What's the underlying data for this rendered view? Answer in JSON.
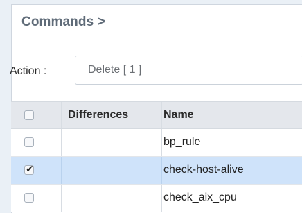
{
  "breadcrumb": "Commands >",
  "action": {
    "label": "Action :",
    "selected": "Delete [ 1 ]"
  },
  "table": {
    "headers": {
      "differences": "Differences",
      "name": "Name"
    },
    "rows": [
      {
        "name": "bp_rule",
        "checked": false
      },
      {
        "name": "check-host-alive",
        "checked": true
      },
      {
        "name": "check_aix_cpu",
        "checked": false
      }
    ],
    "selected_row_color": "#cfe3fa",
    "check_mark": "✔"
  }
}
